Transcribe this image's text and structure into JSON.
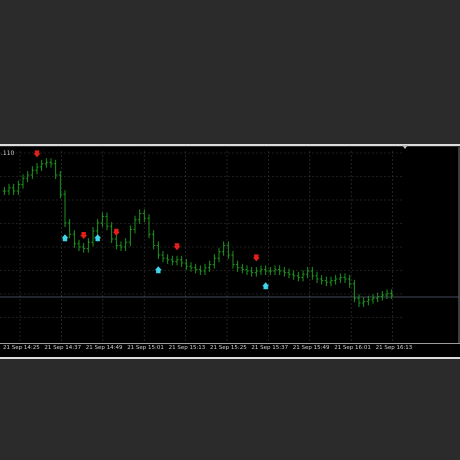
{
  "chart": {
    "price_label": ".110",
    "time_labels": [
      "21 Sep 14:25",
      "21 Sep 14:37",
      "21 Sep 14:49",
      "21 Sep 15:01",
      "21 Sep 15:13",
      "21 Sep 15:25",
      "21 Sep 15:37",
      "21 Sep 15:49",
      "21 Sep 16:01",
      "21 Sep 16:13"
    ],
    "colors": {
      "background": "#000000",
      "candles": "#1fa31f",
      "grid": "#3a3a3a",
      "sell_arrow": "#e0211b",
      "buy_arrow": "#3ed6e8",
      "baseline": "#5a5f7a"
    },
    "signals": {
      "sell": [
        7,
        17,
        24,
        37,
        54
      ],
      "buy": [
        13,
        20,
        33,
        56
      ]
    },
    "closes": [
      0.8,
      0.82,
      0.8,
      0.84,
      0.88,
      0.9,
      0.93,
      0.95,
      0.97,
      0.98,
      0.97,
      0.9,
      0.78,
      0.6,
      0.53,
      0.47,
      0.45,
      0.44,
      0.48,
      0.55,
      0.6,
      0.64,
      0.58,
      0.5,
      0.46,
      0.45,
      0.48,
      0.56,
      0.62,
      0.66,
      0.63,
      0.53,
      0.46,
      0.4,
      0.38,
      0.37,
      0.36,
      0.37,
      0.35,
      0.33,
      0.32,
      0.31,
      0.3,
      0.32,
      0.34,
      0.38,
      0.42,
      0.46,
      0.4,
      0.34,
      0.32,
      0.31,
      0.3,
      0.29,
      0.3,
      0.31,
      0.3,
      0.3,
      0.31,
      0.3,
      0.29,
      0.28,
      0.27,
      0.26,
      0.28,
      0.3,
      0.27,
      0.25,
      0.24,
      0.23,
      0.24,
      0.25,
      0.26,
      0.25,
      0.22,
      0.13,
      0.1,
      0.11,
      0.12,
      0.13,
      0.14,
      0.15,
      0.16,
      0.15
    ]
  }
}
